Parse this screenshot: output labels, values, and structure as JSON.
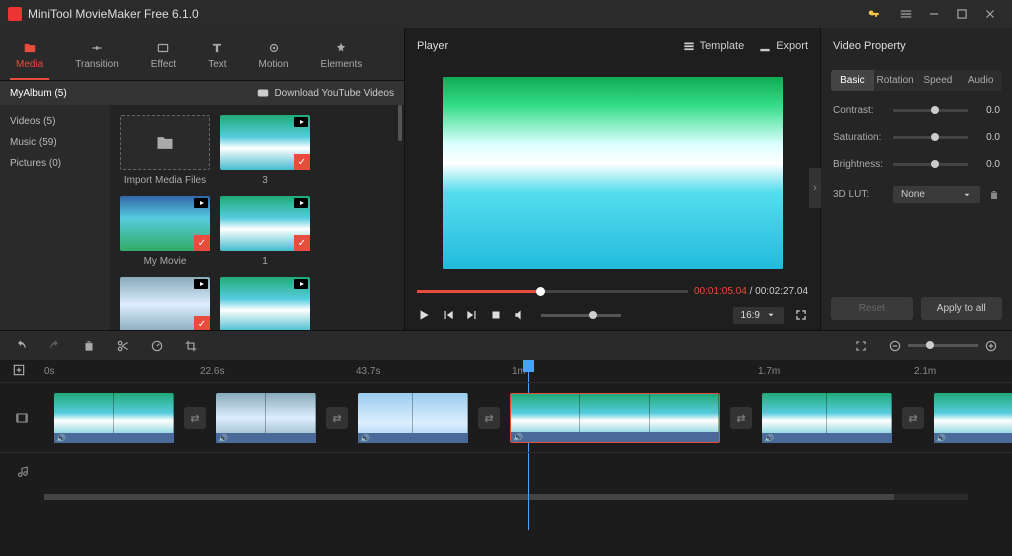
{
  "titlebar": {
    "title": "MiniTool MovieMaker Free 6.1.0"
  },
  "tabs": [
    {
      "label": "Media"
    },
    {
      "label": "Transition"
    },
    {
      "label": "Effect"
    },
    {
      "label": "Text"
    },
    {
      "label": "Motion"
    },
    {
      "label": "Elements"
    }
  ],
  "subbar": {
    "album": "MyAlbum (5)",
    "download": "Download YouTube Videos"
  },
  "cats": [
    {
      "label": "Videos (5)"
    },
    {
      "label": "Music (59)"
    },
    {
      "label": "Pictures (0)"
    }
  ],
  "thumbs": [
    {
      "label": "Import Media Files",
      "import": true
    },
    {
      "label": "3"
    },
    {
      "label": "My Movie"
    },
    {
      "label": "1"
    },
    {
      "label": ""
    },
    {
      "label": ""
    }
  ],
  "player": {
    "title": "Player",
    "template": "Template",
    "export": "Export",
    "time_current": "00:01:05.04",
    "time_total": "00:02:27.04",
    "ratio": "16:9"
  },
  "props": {
    "title": "Video Property",
    "tabs": [
      "Basic",
      "Rotation",
      "Speed",
      "Audio"
    ],
    "contrast_label": "Contrast:",
    "contrast_val": "0.0",
    "saturation_label": "Saturation:",
    "saturation_val": "0.0",
    "brightness_label": "Brightness:",
    "brightness_val": "0.0",
    "lut_label": "3D LUT:",
    "lut_val": "None",
    "reset": "Reset",
    "apply": "Apply to all"
  },
  "ruler": [
    "0s",
    "22.6s",
    "43.7s",
    "1m",
    "1.7m",
    "2.1m"
  ]
}
